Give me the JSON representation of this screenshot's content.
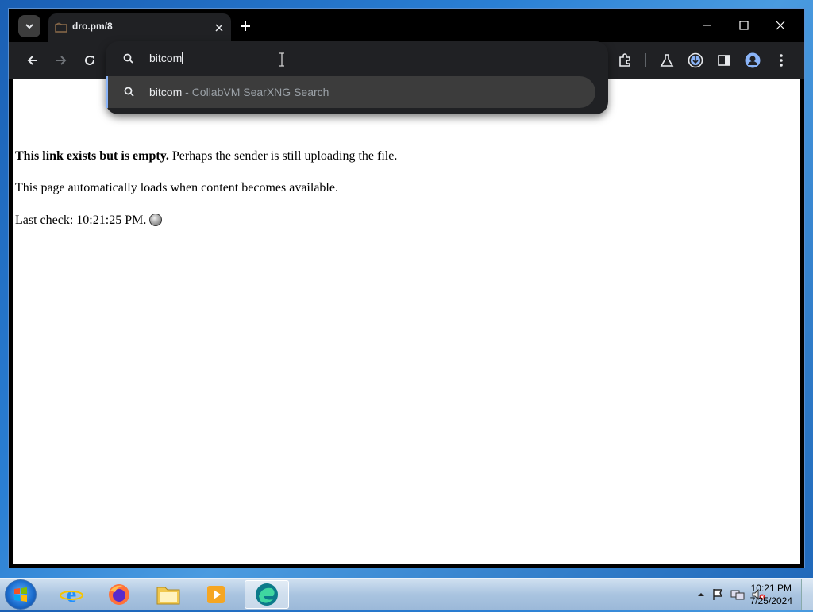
{
  "browser": {
    "tab_title": "dro.pm/8",
    "omnibox_value": "bitcom",
    "suggestion": {
      "query": "bitcom",
      "separator": " - ",
      "engine": "CollabVM SearXNG Search"
    }
  },
  "page": {
    "bold_text": "This link exists but is empty.",
    "line1_rest": " Perhaps the sender is still uploading the file.",
    "line2": "This page automatically loads when content becomes available.",
    "last_check": "Last check: 10:21:25 PM."
  },
  "taskbar": {
    "time": "10:21 PM",
    "date": "7/25/2024",
    "apps": [
      "internet-explorer",
      "firefox",
      "file-explorer",
      "media-player",
      "collabvm-browser"
    ]
  },
  "colors": {
    "accent": "#8ab4f8",
    "toolbar": "#202124",
    "download_ring": "#8ab4f8"
  }
}
